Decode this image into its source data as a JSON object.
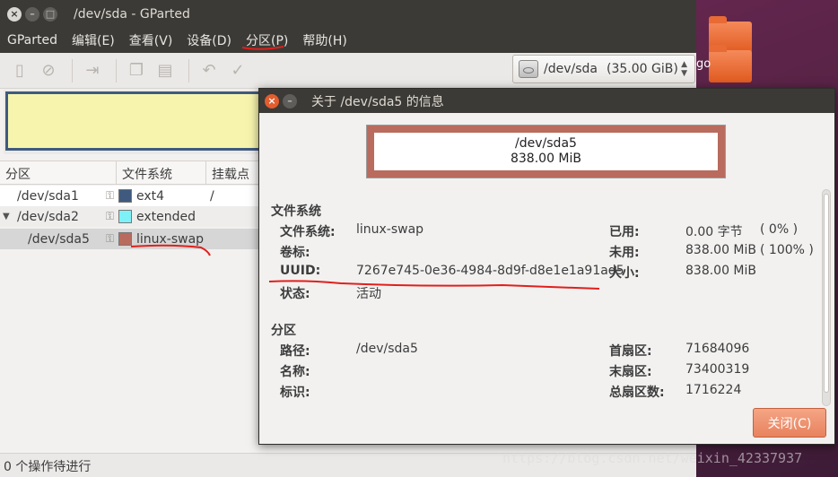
{
  "main_window": {
    "title": "/dev/sda - GParted",
    "menu": [
      "GParted",
      "编辑(E)",
      "查看(V)",
      "设备(D)",
      "分区(P)",
      "帮助(H)"
    ],
    "device": {
      "name": "/dev/sda",
      "size": "(35.00 GiB)"
    },
    "table": {
      "headers": [
        "分区",
        "文件系统",
        "挂载点"
      ],
      "rows": [
        {
          "name": "/dev/sda1",
          "fs": "ext4",
          "mount": "/",
          "color": "#3f5a7e"
        },
        {
          "name": "/dev/sda2",
          "fs": "extended",
          "mount": "",
          "color": "#7df1f8"
        },
        {
          "name": "/dev/sda5",
          "fs": "linux-swap",
          "mount": "",
          "color": "#b96b5d"
        }
      ]
    },
    "status": "0 个操作待进行"
  },
  "dialog": {
    "title": "关于 /dev/sda5 的信息",
    "graphic": {
      "name": "/dev/sda5",
      "size": "838.00 MiB"
    },
    "fs_section": {
      "heading": "文件系统",
      "fs_label": "文件系统:",
      "fs_value": "linux-swap",
      "vol_label": "卷标:",
      "vol_value": "",
      "uuid_label": "UUID:",
      "uuid_value": "7267e745-0e36-4984-8d9f-d8e1e1a91ad5",
      "state_label": "状态:",
      "state_value": "活动",
      "used_label": "已用:",
      "used_value": "0.00 字节",
      "used_pct": "( 0% )",
      "unused_label": "未用:",
      "unused_value": "838.00 MiB",
      "unused_pct": "( 100% )",
      "size_label": "大小:",
      "size_value": "838.00 MiB"
    },
    "part_section": {
      "heading": "分区",
      "path_label": "路径:",
      "path_value": "/dev/sda5",
      "name_label": "名称:",
      "name_value": "",
      "flags_label": "标识:",
      "flags_value": "",
      "first_label": "首扇区:",
      "first_value": "71684096",
      "last_label": "末扇区:",
      "last_value": "73400319",
      "total_label": "总扇区数:",
      "total_value": "1716224"
    },
    "close_label": "关闭(C)"
  },
  "desktop": {
    "folder_label": "go"
  },
  "watermark": "https://blog.csdn.net/weixin_42337937",
  "annotation_color": "#e0201c"
}
